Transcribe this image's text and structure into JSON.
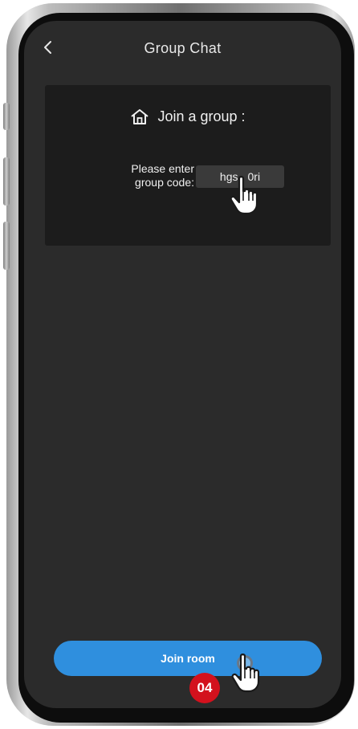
{
  "header": {
    "title": "Group Chat",
    "back_icon": "chevron-left-icon"
  },
  "join_card": {
    "heading": "Join a group :",
    "heading_icon": "house-icon",
    "label_line1": "Please enter",
    "label_line2": "group code:",
    "code_value": "hgs",
    "code_value_tail": "0ri"
  },
  "join_button": {
    "label": "Join room"
  },
  "step_badge": {
    "label": "04"
  },
  "colors": {
    "screen_background": "#2b2b2b",
    "card_background": "#1c1c1c",
    "input_background": "#3a3a3a",
    "button_accent": "#2f8fde",
    "badge_red": "#d3111d"
  }
}
